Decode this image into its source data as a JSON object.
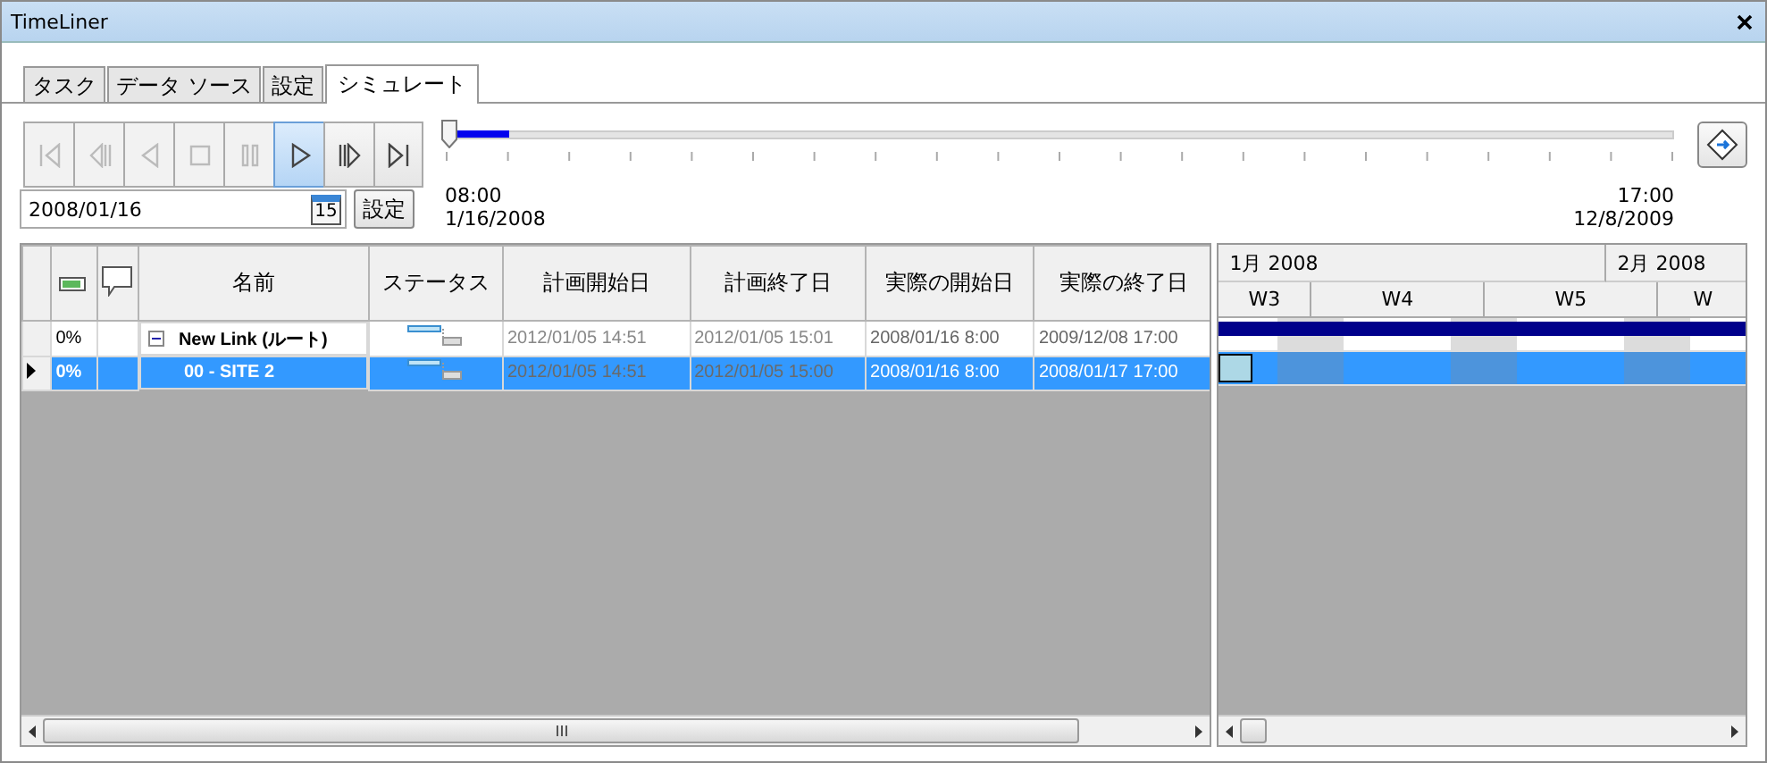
{
  "window": {
    "title": "TimeLiner"
  },
  "tabs": [
    {
      "label": "タスク",
      "selected": false
    },
    {
      "label": "データ ソース",
      "selected": false
    },
    {
      "label": "設定",
      "selected": false
    },
    {
      "label": "シミュレート",
      "selected": true
    }
  ],
  "transport": [
    {
      "kind": "first",
      "disabled": true,
      "selected": false
    },
    {
      "kind": "step-back",
      "disabled": true,
      "selected": false
    },
    {
      "kind": "reverse",
      "disabled": true,
      "selected": false
    },
    {
      "kind": "stop",
      "disabled": true,
      "selected": false
    },
    {
      "kind": "pause",
      "disabled": true,
      "selected": false
    },
    {
      "kind": "play",
      "disabled": false,
      "selected": true
    },
    {
      "kind": "step-forward",
      "disabled": false,
      "selected": false
    },
    {
      "kind": "last",
      "disabled": false,
      "selected": false
    }
  ],
  "timeline": {
    "level": 0.05,
    "start_time": "08:00",
    "start_date": "1/16/2008",
    "end_time": "17:00",
    "end_date": "12/8/2009"
  },
  "date_field": {
    "value": "2008/01/16",
    "calendar_day": "15"
  },
  "set_button": "設定",
  "table": {
    "columns": [
      "名前",
      "ステータス",
      "計画開始日",
      "計画終了日",
      "実際の開始日",
      "実際の終了日"
    ],
    "rows": [
      {
        "progress": "0%",
        "name": "New Link (ルート)",
        "expanded": true,
        "current": false,
        "selected": false,
        "planned_start": "2012/01/05 14:51",
        "planned_end": "2012/01/05 15:01",
        "actual_start": "2008/01/16 8:00",
        "actual_end": "2009/12/08 17:00",
        "children": [
          {
            "progress": "0%",
            "name": "00 - SITE 2",
            "current": true,
            "selected": true,
            "planned_start": "2012/01/05 14:51",
            "planned_end": "2012/01/05 15:00",
            "actual_start": "2008/01/16 8:00",
            "actual_end": "2008/01/17 17:00"
          }
        ]
      }
    ]
  },
  "gantt": {
    "months": [
      "1月 2008",
      "2月 2008"
    ],
    "weeks": [
      "W3",
      "W4",
      "W5",
      "W"
    ]
  }
}
